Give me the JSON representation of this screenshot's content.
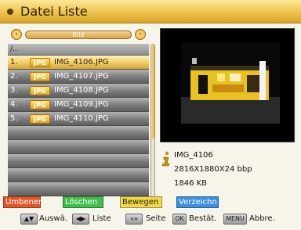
{
  "header": {
    "title": "Datei Liste",
    "icon": "circle-icon"
  },
  "selector": {
    "label": "Bild"
  },
  "list": {
    "path": "/..",
    "items": [
      {
        "num": "1.",
        "badge": "JPG",
        "name": "IMG_4106.JPG",
        "selected": true
      },
      {
        "num": "2.",
        "badge": "JPG",
        "name": "IMG_4107.JPG",
        "selected": false
      },
      {
        "num": "3.",
        "badge": "JPG",
        "name": "IMG_4108.JPG",
        "selected": false
      },
      {
        "num": "4.",
        "badge": "JPG",
        "name": "IMG_4109.JPG",
        "selected": false
      },
      {
        "num": "5.",
        "badge": "JPG",
        "name": "IMG_4110.JPG",
        "selected": false
      },
      {
        "num": "",
        "badge": "",
        "name": "",
        "selected": false
      },
      {
        "num": "",
        "badge": "",
        "name": "",
        "selected": false
      },
      {
        "num": "",
        "badge": "",
        "name": "",
        "selected": false
      },
      {
        "num": "",
        "badge": "",
        "name": "",
        "selected": false
      },
      {
        "num": "",
        "badge": "",
        "name": "",
        "selected": false
      }
    ]
  },
  "info": {
    "name": "IMG_4106",
    "resolution": "2816X1880X24 bbp",
    "size": "1846 KB"
  },
  "color_buttons": {
    "red": "Umbenen",
    "green": "Löschen",
    "yellow": "Bewegen",
    "blue": "Verzeichn"
  },
  "hints": {
    "nav_key": "▲▼",
    "nav_label": "Auswä.",
    "list_key": "◀▶",
    "list_label": "Liste",
    "page_key": "«»",
    "page_label": "Seite",
    "ok_key": "OK",
    "ok_label": "Bestät.",
    "menu_key": "MENU",
    "menu_label": "Abbre."
  }
}
